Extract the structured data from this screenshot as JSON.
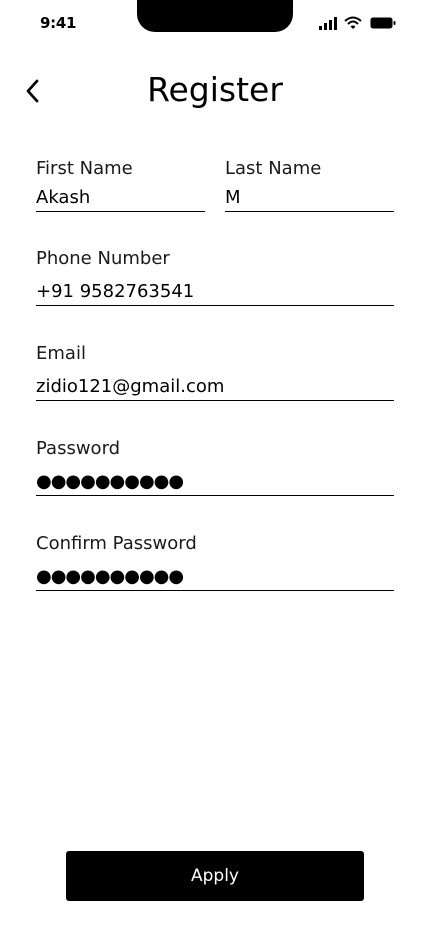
{
  "status_bar": {
    "time": "9:41"
  },
  "header": {
    "title": "Register"
  },
  "form": {
    "first_name": {
      "label": "First Name",
      "value": "Akash"
    },
    "last_name": {
      "label": "Last Name",
      "value": "M"
    },
    "phone": {
      "label": "Phone Number",
      "value": "+91 9582763541"
    },
    "email": {
      "label": "Email",
      "value": "zidio121@gmail.com"
    },
    "password": {
      "label": "Password",
      "mask": "●●●●●●●●●●"
    },
    "confirm_password": {
      "label": "Confirm Password",
      "mask": "●●●●●●●●●●"
    }
  },
  "apply_label": "Apply",
  "icons": {
    "back": "chevron-left-icon",
    "signal": "cellular-signal-icon",
    "wifi": "wifi-icon",
    "battery": "battery-icon"
  }
}
